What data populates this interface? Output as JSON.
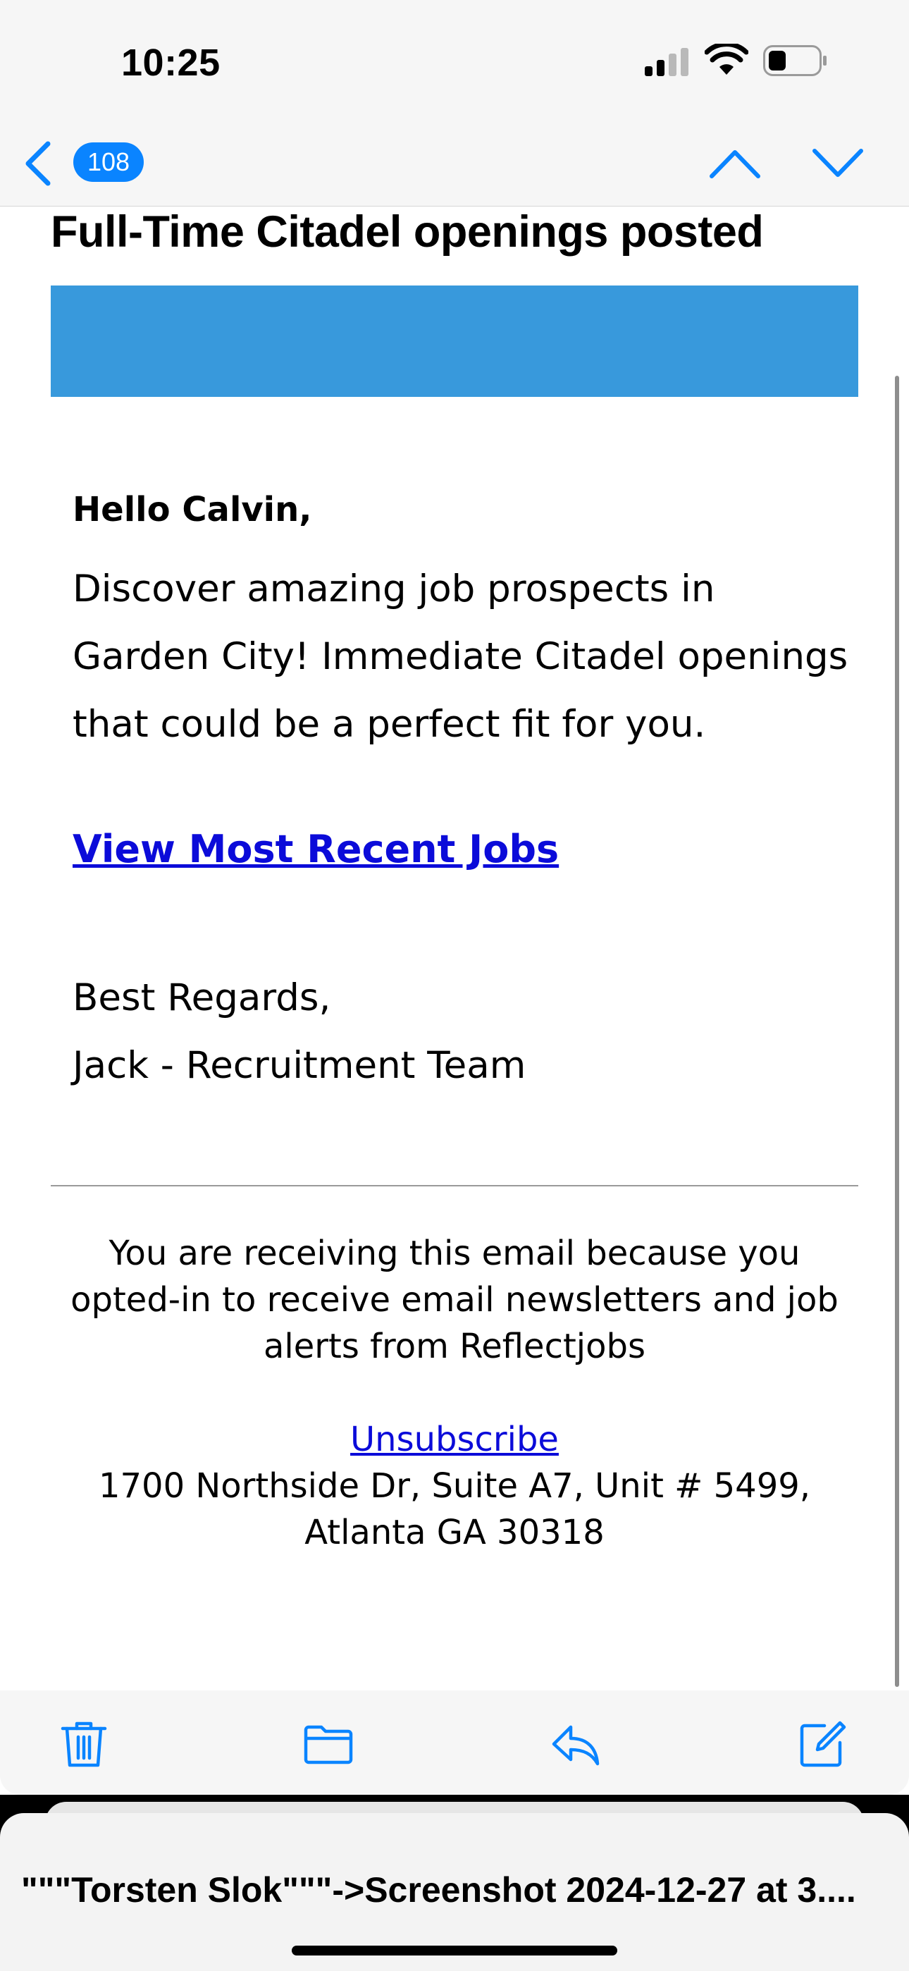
{
  "status_bar": {
    "time": "10:25",
    "icons": [
      "cellular-signal-icon",
      "wifi-icon",
      "battery-icon"
    ]
  },
  "nav": {
    "message_count": "108",
    "icons": [
      "back-chevron-icon",
      "previous-message-icon",
      "next-message-icon"
    ],
    "accent_color": "#0a84ff"
  },
  "email": {
    "subject": "Full-Time Citadel openings posted",
    "banner_color": "#3899dc",
    "greeting": "Hello Calvin,",
    "intro_lines": [
      "Discover amazing job prospects in",
      "Garden City! Immediate Citadel openings",
      "that could be a perfect fit for you."
    ],
    "cta_link": "View Most Recent Jobs",
    "signoff": "Best Regards,",
    "signature": "Jack - Recruitment Team",
    "footer_lines": [
      "You are receiving this email because you",
      "opted-in to receive email newsletters and job",
      "alerts from Reflectjobs"
    ],
    "unsubscribe": "Unsubscribe",
    "address_line1": "1700 Northside Dr, Suite A7, Unit # 5499,",
    "address_line2": "Atlanta GA 30318",
    "link_color": "#0b0bd9"
  },
  "toolbar": {
    "icons": [
      "trash-icon",
      "folder-icon",
      "reply-icon",
      "compose-icon"
    ]
  },
  "share_sheet": {
    "title": "\"\"\"Torsten Slok\"\"\"->Screenshot 2024-12-27 at 3...."
  }
}
